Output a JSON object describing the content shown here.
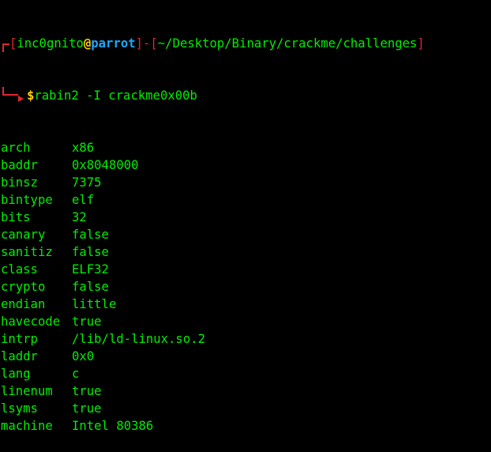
{
  "prompt": {
    "user": "inc0gnito",
    "at": "@",
    "host": "parrot",
    "separator": "]-[",
    "open": "[",
    "close": "]",
    "path": "~/Desktop/Binary/crackme/challenges",
    "dollar": "$",
    "command": "rabin2 -I crackme0x00b"
  },
  "colors": {
    "background": "#000000",
    "text": "#00ee00",
    "bracket": "#e0282e",
    "host": "#19a8ff",
    "at_and_dollar": "#ffd000"
  },
  "output": [
    {
      "key": "arch",
      "value": "x86"
    },
    {
      "key": "baddr",
      "value": "0x8048000"
    },
    {
      "key": "binsz",
      "value": "7375"
    },
    {
      "key": "bintype",
      "value": "elf"
    },
    {
      "key": "bits",
      "value": "32"
    },
    {
      "key": "canary",
      "value": "false"
    },
    {
      "key": "sanitiz",
      "value": "false"
    },
    {
      "key": "class",
      "value": "ELF32"
    },
    {
      "key": "crypto",
      "value": "false"
    },
    {
      "key": "endian",
      "value": "little"
    },
    {
      "key": "havecode",
      "value": "true"
    },
    {
      "key": "intrp",
      "value": "/lib/ld-linux.so.2"
    },
    {
      "key": "laddr",
      "value": "0x0"
    },
    {
      "key": "lang",
      "value": "c"
    },
    {
      "key": "linenum",
      "value": "true"
    },
    {
      "key": "lsyms",
      "value": "true"
    },
    {
      "key": "machine",
      "value": "Intel 80386"
    }
  ]
}
